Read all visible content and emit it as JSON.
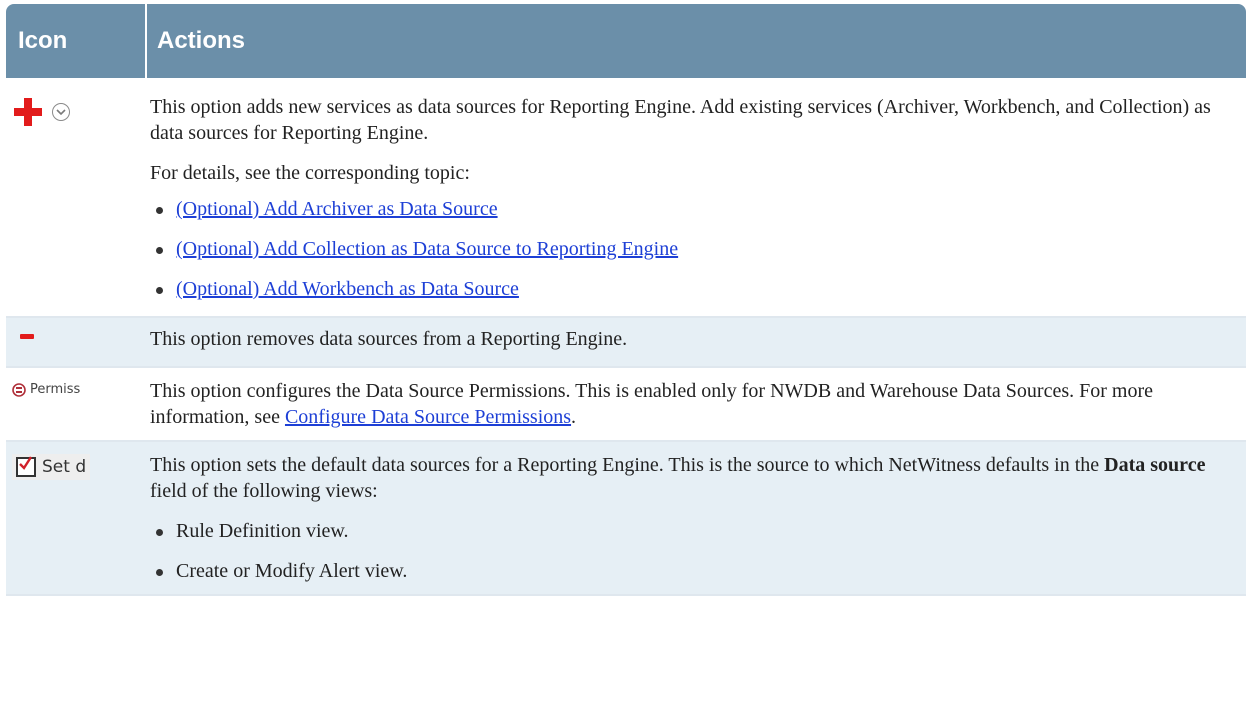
{
  "header": {
    "col_icon": "Icon",
    "col_actions": "Actions"
  },
  "rows": {
    "add": {
      "icon_names": [
        "plus-icon",
        "chevron-down-icon"
      ],
      "p1": "This option adds new services as data sources for Reporting Engine. Add existing services (Archiver, Workbench, and Collection) as data sources for Reporting Engine.",
      "p2": "For details, see the corresponding topic:",
      "links": [
        "(Optional) Add Archiver as Data Source",
        "(Optional) Add Collection as Data Source to Reporting Engine",
        "(Optional) Add Workbench as Data Source"
      ]
    },
    "remove": {
      "icon_name": "minus-icon",
      "text": "This option removes data sources from a Reporting Engine."
    },
    "permissions": {
      "icon_label": "Permiss",
      "text_pre": "This option configures the Data Source Permissions. This is enabled only for NWDB and Warehouse Data Sources. For more information, see ",
      "link": "Configure Data Source Permissions",
      "text_post": "."
    },
    "setdefault": {
      "icon_label": "Set d",
      "text_pre": "This option sets the default data sources for a Reporting Engine. This is the source to which NetWitness defaults in the ",
      "bold": "Data source",
      "text_post": " field of the following views:",
      "items": [
        "Rule Definition view.",
        "Create or Modify Alert view."
      ]
    }
  },
  "colors": {
    "header_bg": "#6b8fa9",
    "row_alt_bg": "#e6eff5",
    "icon_red": "#e21b1b",
    "link": "#1d3fd6"
  }
}
